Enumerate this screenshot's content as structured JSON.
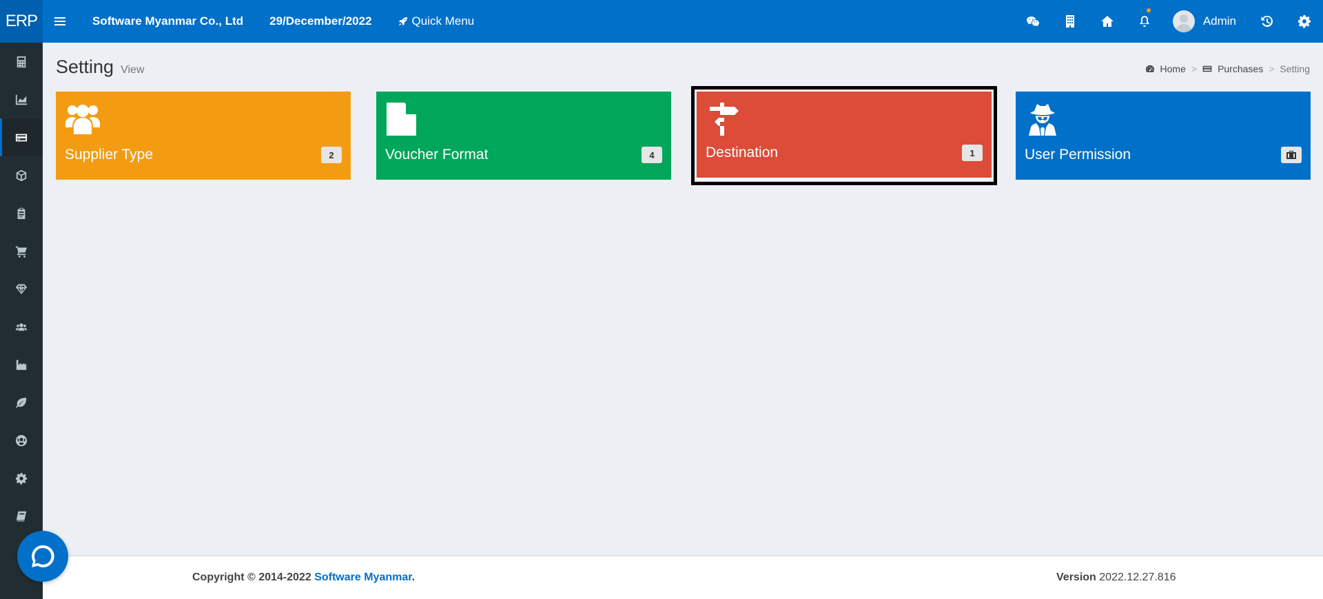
{
  "header": {
    "logo": "ERP",
    "company": "Software Myanmar Co., Ltd",
    "date": "29/December/2022",
    "quick_menu": "Quick Menu",
    "user_name": "Admin"
  },
  "sidebar": {
    "items": [
      {
        "icon": "calculator-icon"
      },
      {
        "icon": "area-chart-icon"
      },
      {
        "icon": "credit-card-icon",
        "active": true
      },
      {
        "icon": "cube-icon"
      },
      {
        "icon": "clipboard-icon"
      },
      {
        "icon": "cart-icon"
      },
      {
        "icon": "diamond-icon"
      },
      {
        "icon": "users-icon"
      },
      {
        "icon": "industry-icon"
      },
      {
        "icon": "leaf-icon"
      },
      {
        "icon": "soccer-ball-icon"
      },
      {
        "icon": "gear-icon"
      },
      {
        "icon": "book-icon"
      }
    ]
  },
  "page": {
    "title": "Setting",
    "subtitle": "View"
  },
  "breadcrumb": {
    "home": "Home",
    "section": "Purchases",
    "current": "Setting",
    "separator": ">"
  },
  "boxes": [
    {
      "label": "Supplier Type",
      "count": "2",
      "icon": "users-icon",
      "color": "#f39c12"
    },
    {
      "label": "Voucher Format",
      "count": "4",
      "icon": "file-icon",
      "color": "#00a65a"
    },
    {
      "label": "Destination",
      "count": "1",
      "icon": "signpost-icon",
      "color": "#dd4b39"
    },
    {
      "label": "User Permission",
      "count": "",
      "icon": "user-secret-icon",
      "color": "#0070c9"
    }
  ],
  "footer": {
    "copyright": "Copyright © 2014-2022",
    "company_link": "Software Myanmar",
    "period": ".",
    "version_label": "Version",
    "version": "2022.12.27.816"
  },
  "colors": {
    "primary": "#0070c9",
    "sidebar": "#222d32",
    "background": "#ecf0f5"
  }
}
